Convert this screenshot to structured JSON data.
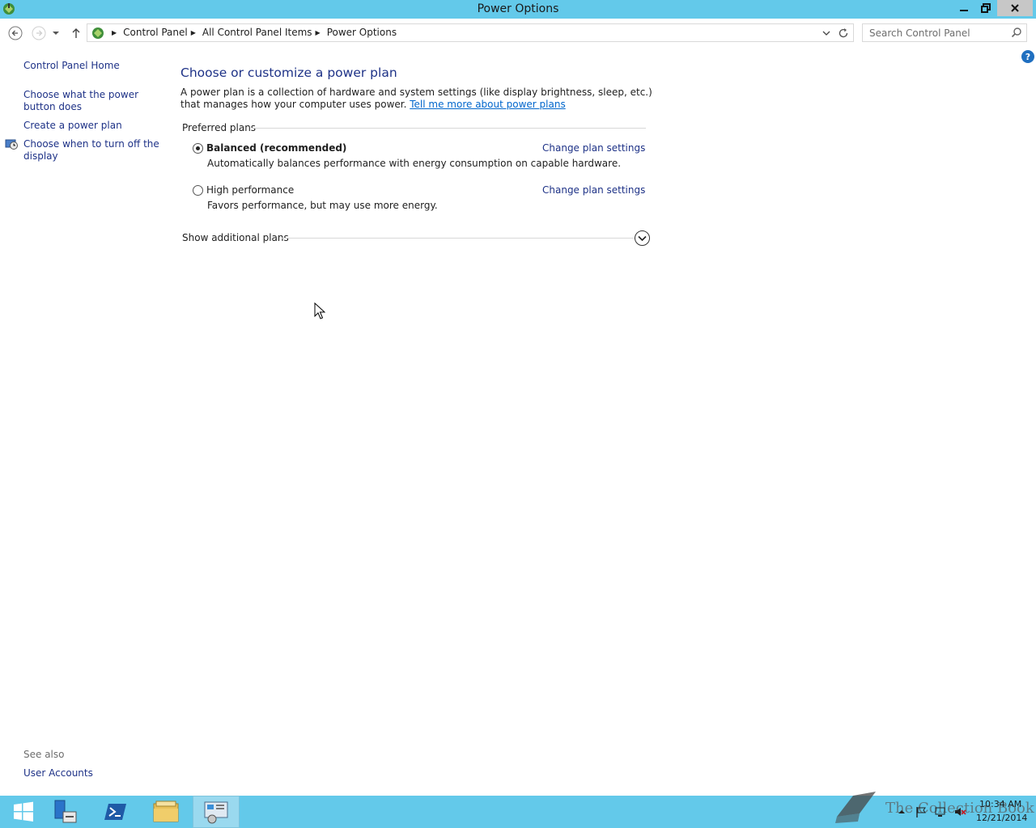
{
  "window": {
    "title": "Power Options"
  },
  "address": {
    "crumbs": [
      "Control Panel",
      "All Control Panel Items",
      "Power Options"
    ],
    "search_placeholder": "Search Control Panel"
  },
  "left_pane": {
    "home": "Control Panel Home",
    "power_button": "Choose what the power button does",
    "create_plan": "Create a power plan",
    "turn_off_display": "Choose when to turn off the display",
    "see_also": "See also",
    "user_accounts": "User Accounts"
  },
  "main": {
    "title": "Choose or customize a power plan",
    "description": "A power plan is a collection of hardware and system settings (like display brightness, sleep, etc.) that manages how your computer uses power.",
    "description_link": "Tell me more about power plans",
    "preferred_plans_label": "Preferred plans",
    "plans": [
      {
        "name": "Balanced (recommended)",
        "description": "Automatically balances performance with energy consumption on capable hardware.",
        "change_label": "Change plan settings",
        "selected": true
      },
      {
        "name": "High performance",
        "description": "Favors performance, but may use more energy.",
        "change_label": "Change plan settings",
        "selected": false
      }
    ],
    "show_additional": "Show additional plans"
  },
  "taskbar": {
    "watermark": "The Collection Book",
    "time": "10:34 AM",
    "date": "12/21/2014"
  },
  "colors": {
    "titlebar": "#63c9ea",
    "link": "#1e3287",
    "hyperlink": "#0066cc"
  }
}
